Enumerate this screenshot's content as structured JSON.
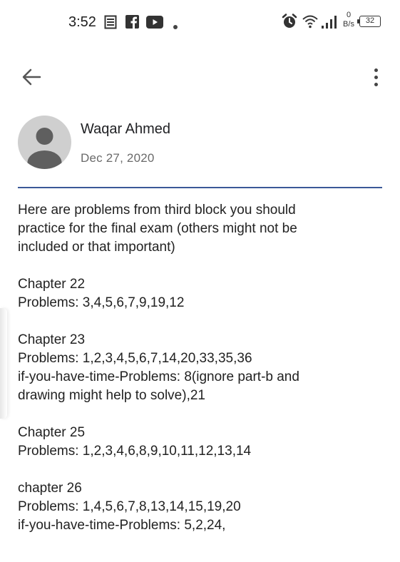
{
  "status_bar": {
    "time": "3:52",
    "net_speed_value": "0",
    "net_speed_unit": "B/s",
    "battery": "32"
  },
  "app_bar": {
    "back_icon": "arrow-back-icon",
    "more_icon": "more-vert-icon"
  },
  "message": {
    "sender_name": "Waqar Ahmed",
    "date": "Dec 27, 2020",
    "body": {
      "intro": [
        "Here are problems from third block you should",
        "practice for the final exam (others might not be",
        "included or that important)"
      ],
      "chapters": [
        {
          "lines": [
            "Chapter 22",
            "Problems: 3,4,5,6,7,9,19,12"
          ]
        },
        {
          "lines": [
            "Chapter 23",
            "Problems: 1,2,3,4,5,6,7,14,20,33,35,36",
            "if-you-have-time-Problems: 8(ignore part-b and",
            "drawing might help to solve),21"
          ]
        },
        {
          "lines": [
            "Chapter 25",
            "Problems: 1,2,3,4,6,8,9,10,11,12,13,14"
          ]
        },
        {
          "lines": [
            "chapter 26",
            "Problems: 1,4,5,6,7,8,13,14,15,19,20",
            "if-you-have-time-Problems: 5,2,24,"
          ]
        }
      ]
    }
  },
  "colors": {
    "divider": "#3b5998",
    "avatar_bg": "#cfcfcf",
    "avatar_fg": "#5f5f5f"
  }
}
